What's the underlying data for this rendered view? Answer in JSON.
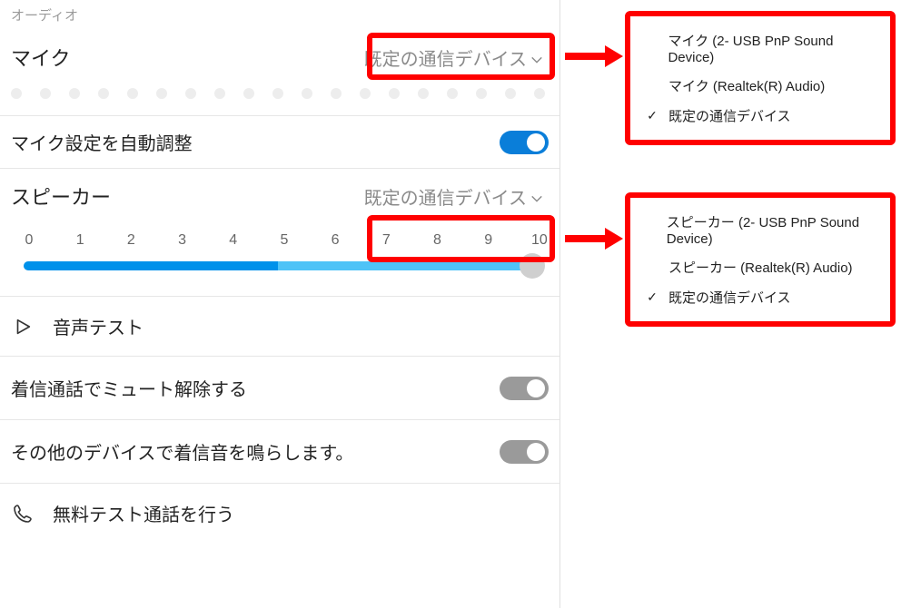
{
  "section_audio": "オーディオ",
  "mic": {
    "label": "マイク",
    "selected": "既定の通信デバイス",
    "options": [
      "マイク (2- USB PnP Sound Device)",
      "マイク (Realtek(R) Audio)",
      "既定の通信デバイス"
    ],
    "selected_index": 2
  },
  "auto_adjust": {
    "label": "マイク設定を自動調整",
    "on": true
  },
  "speaker": {
    "label": "スピーカー",
    "selected": "既定の通信デバイス",
    "options": [
      "スピーカー (2- USB PnP Sound Device)",
      "スピーカー (Realtek(R) Audio)",
      "既定の通信デバイス"
    ],
    "selected_index": 2
  },
  "volume_slider": {
    "ticks": [
      "0",
      "1",
      "2",
      "3",
      "4",
      "5",
      "6",
      "7",
      "8",
      "9",
      "10"
    ],
    "value": 10,
    "max": 10
  },
  "audio_test": "音声テスト",
  "unmute_incoming": {
    "label": "着信通話でミュート解除する",
    "on": false
  },
  "other_device_ring": {
    "label": "その他のデバイスで着信音を鳴らします。",
    "on": false
  },
  "free_test_call": "無料テスト通話を行う"
}
